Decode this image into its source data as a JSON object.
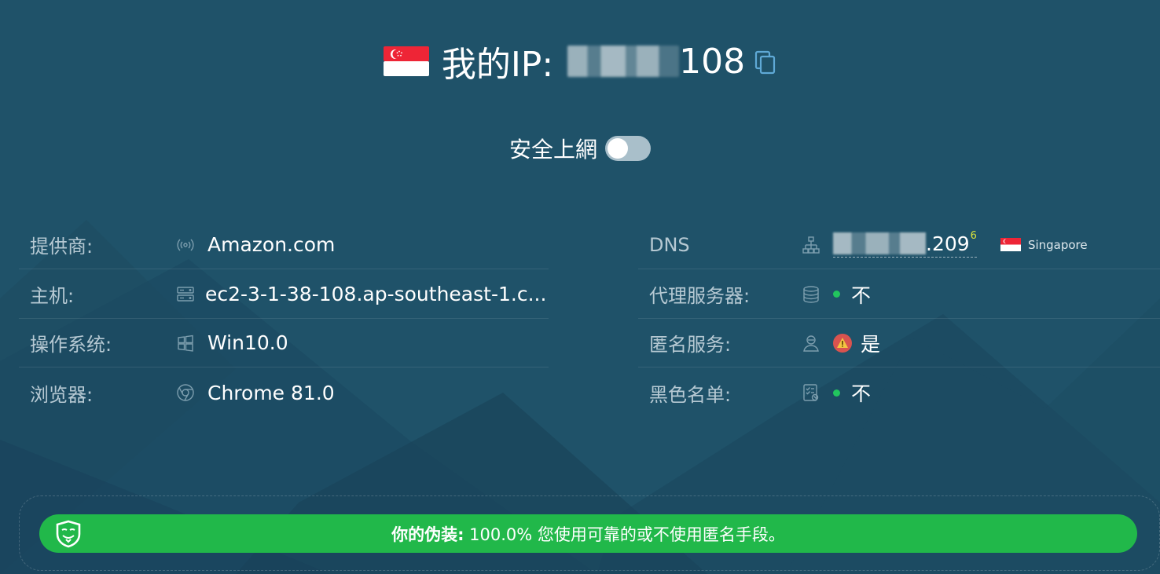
{
  "header": {
    "title_prefix": "我的IP:",
    "ip_visible_suffix": "108",
    "flag_icon": "singapore-flag-icon",
    "copy_icon": "copy-icon"
  },
  "safe_browsing": {
    "label": "安全上網",
    "enabled": false
  },
  "left_rows": [
    {
      "label": "提供商:",
      "icon": "broadcast-icon",
      "value": "Amazon.com"
    },
    {
      "label": "主机:",
      "icon": "server-icon",
      "value": "ec2-3-1-38-108.ap-southeast-1.c..."
    },
    {
      "label": "操作系统:",
      "icon": "windows-icon",
      "value": "Win10.0"
    },
    {
      "label": "浏览器:",
      "icon": "chrome-icon",
      "value": "Chrome 81.0"
    }
  ],
  "right_rows": [
    {
      "label": "DNS",
      "icon": "network-icon",
      "value_suffix": ".209",
      "superscript": "6",
      "country": "Singapore"
    },
    {
      "label": "代理服务器:",
      "icon": "database-icon",
      "value": "不"
    },
    {
      "label": "匿名服务:",
      "icon": "anonymous-user-icon",
      "value": "是"
    },
    {
      "label": "黑色名单:",
      "icon": "checklist-icon",
      "value": "不"
    }
  ],
  "footer": {
    "strong": "你的伪装:",
    "text": " 100.0% 您使用可靠的或不使用匿名手段。"
  },
  "colors": {
    "background": "#1f5269",
    "success": "#21b84a",
    "status_dot": "#22c55e",
    "warning": "#d9534f"
  }
}
